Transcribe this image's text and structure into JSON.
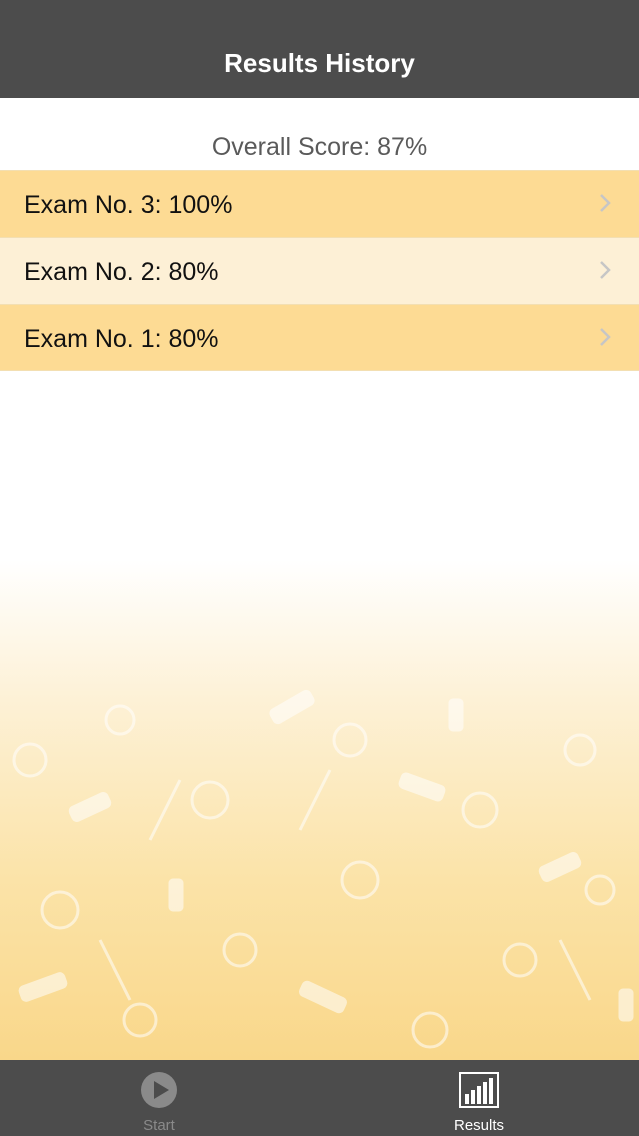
{
  "header": {
    "title": "Results History"
  },
  "summary": {
    "overall_score": "Overall Score: 87%"
  },
  "exams": [
    {
      "label": "Exam No. 3:  100%"
    },
    {
      "label": "Exam No. 2:  80%"
    },
    {
      "label": "Exam No. 1:  80%"
    }
  ],
  "tabbar": {
    "tabs": [
      {
        "label": "Start",
        "icon": "play-icon",
        "active": false
      },
      {
        "label": "Results",
        "icon": "bar-chart-icon",
        "active": true
      }
    ]
  },
  "colors": {
    "nav_background": "#4c4c4c",
    "row_dark": "#fddb94",
    "row_light": "#fdf0d6",
    "tab_active": "#ffffff",
    "tab_inactive": "#8a8a8a"
  }
}
